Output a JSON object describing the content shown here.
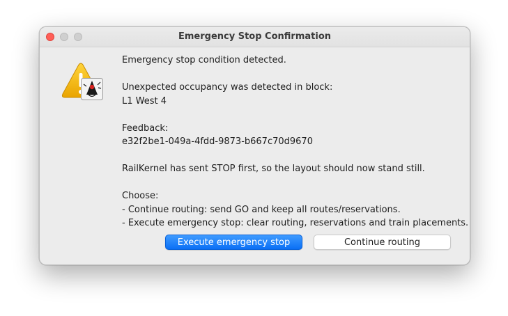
{
  "window": {
    "title": "Emergency Stop Confirmation"
  },
  "icons": {
    "main": "warning-icon",
    "badge": "java-duke-icon",
    "accent_warning": "#f2b625"
  },
  "message": {
    "line1": "Emergency stop condition detected.",
    "line2": "Unexpected occupancy was detected in block:",
    "line3": "L1 West 4",
    "line4": "Feedback:",
    "line5": "e32f2be1-049a-4fdd-9873-b667c70d9670",
    "line6": "RailKernel has sent STOP first, so the layout should now stand still.",
    "line7": "Choose:",
    "line8": "- Continue routing: send GO and keep all routes/reservations.",
    "line9": "- Execute emergency stop: clear routing, reservations and train placements."
  },
  "buttons": {
    "execute_label": "Execute emergency stop",
    "continue_label": "Continue routing"
  },
  "colors": {
    "primary_button": "#0a6ff5",
    "close_light": "#ff5f57"
  }
}
